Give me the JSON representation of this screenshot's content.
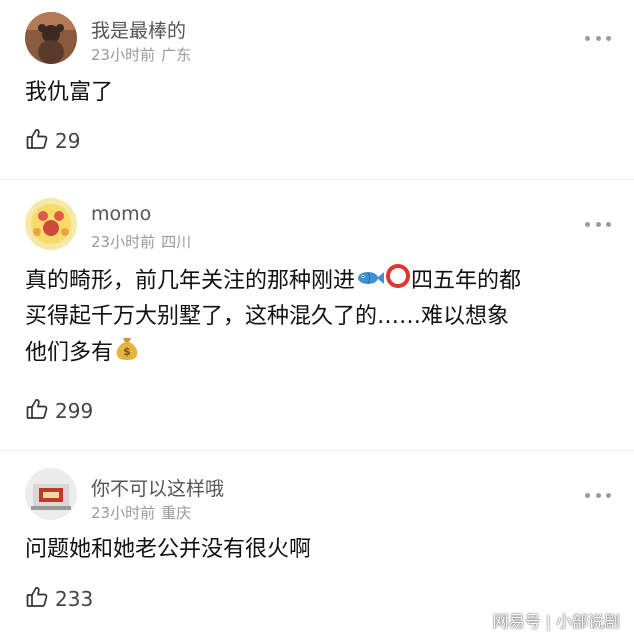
{
  "comments": [
    {
      "username": "我是最棒的",
      "time": "23小时前",
      "location": "广东",
      "lines": [
        "我仇富了"
      ],
      "likes": "29"
    },
    {
      "username": "momo",
      "time": "23小时前",
      "location": "四川",
      "lines": [
        "真的畸形，前几年关注的那种刚进",
        "四五年的都",
        "买得起千万大别墅了，这种混久了的……难以想象",
        "他们多有"
      ],
      "likes": "299"
    },
    {
      "username": "你不可以这样哦",
      "time": "23小时前",
      "location": "重庆",
      "lines": [
        "问题她和她老公并没有很火啊"
      ],
      "likes": "233"
    }
  ],
  "watermark": {
    "brand": "网易号",
    "separator": "|",
    "account": "小部说剧"
  },
  "icons": {
    "like": "thumbs-up-icon",
    "more": "more-dots-icon",
    "fish": "fish-emoji-icon",
    "circle": "red-circle-emoji-icon",
    "money": "money-bag-emoji-icon"
  },
  "colors": {
    "username": "#555555",
    "meta": "#9a9a9a",
    "body": "#111111",
    "circle": "#e8322d"
  }
}
